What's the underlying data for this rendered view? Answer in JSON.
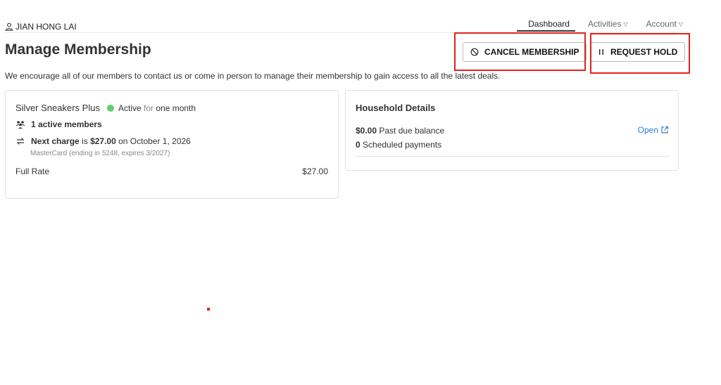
{
  "nav": {
    "user_name": "JIAN HONG LAI",
    "links": [
      {
        "label": "Dashboard"
      },
      {
        "label": "Activities"
      },
      {
        "label": "Account"
      }
    ]
  },
  "header": {
    "title": "Manage Membership",
    "cancel_label": "CANCEL MEMBERSHIP",
    "hold_label": "REQUEST HOLD"
  },
  "intro": "We encourage all of our members to contact us or come in person to manage their membership to gain access to all the latest deals.",
  "membership": {
    "plan_name": "Silver Sneakers Plus",
    "status": "Active",
    "status_for": "for",
    "status_duration": "one month",
    "active_members": "1 active members",
    "next_charge_label": "Next charge",
    "next_charge_is": "is",
    "next_charge_amount": "$27.00",
    "next_charge_on": "on October 1, 2026",
    "payment_method": "MasterCard (ending in 5248, expires 3/2027)",
    "rate_label": "Full Rate",
    "rate_value": "$27.00",
    "status_color": "#5fd06a"
  },
  "household": {
    "title": "Household Details",
    "past_due_amount": "$0.00",
    "past_due_label": "Past due balance",
    "scheduled_count": "0",
    "scheduled_label": "Scheduled payments",
    "open_label": "Open"
  },
  "colors": {
    "accent": "#2f7bd6",
    "highlight": "#e0231c"
  }
}
